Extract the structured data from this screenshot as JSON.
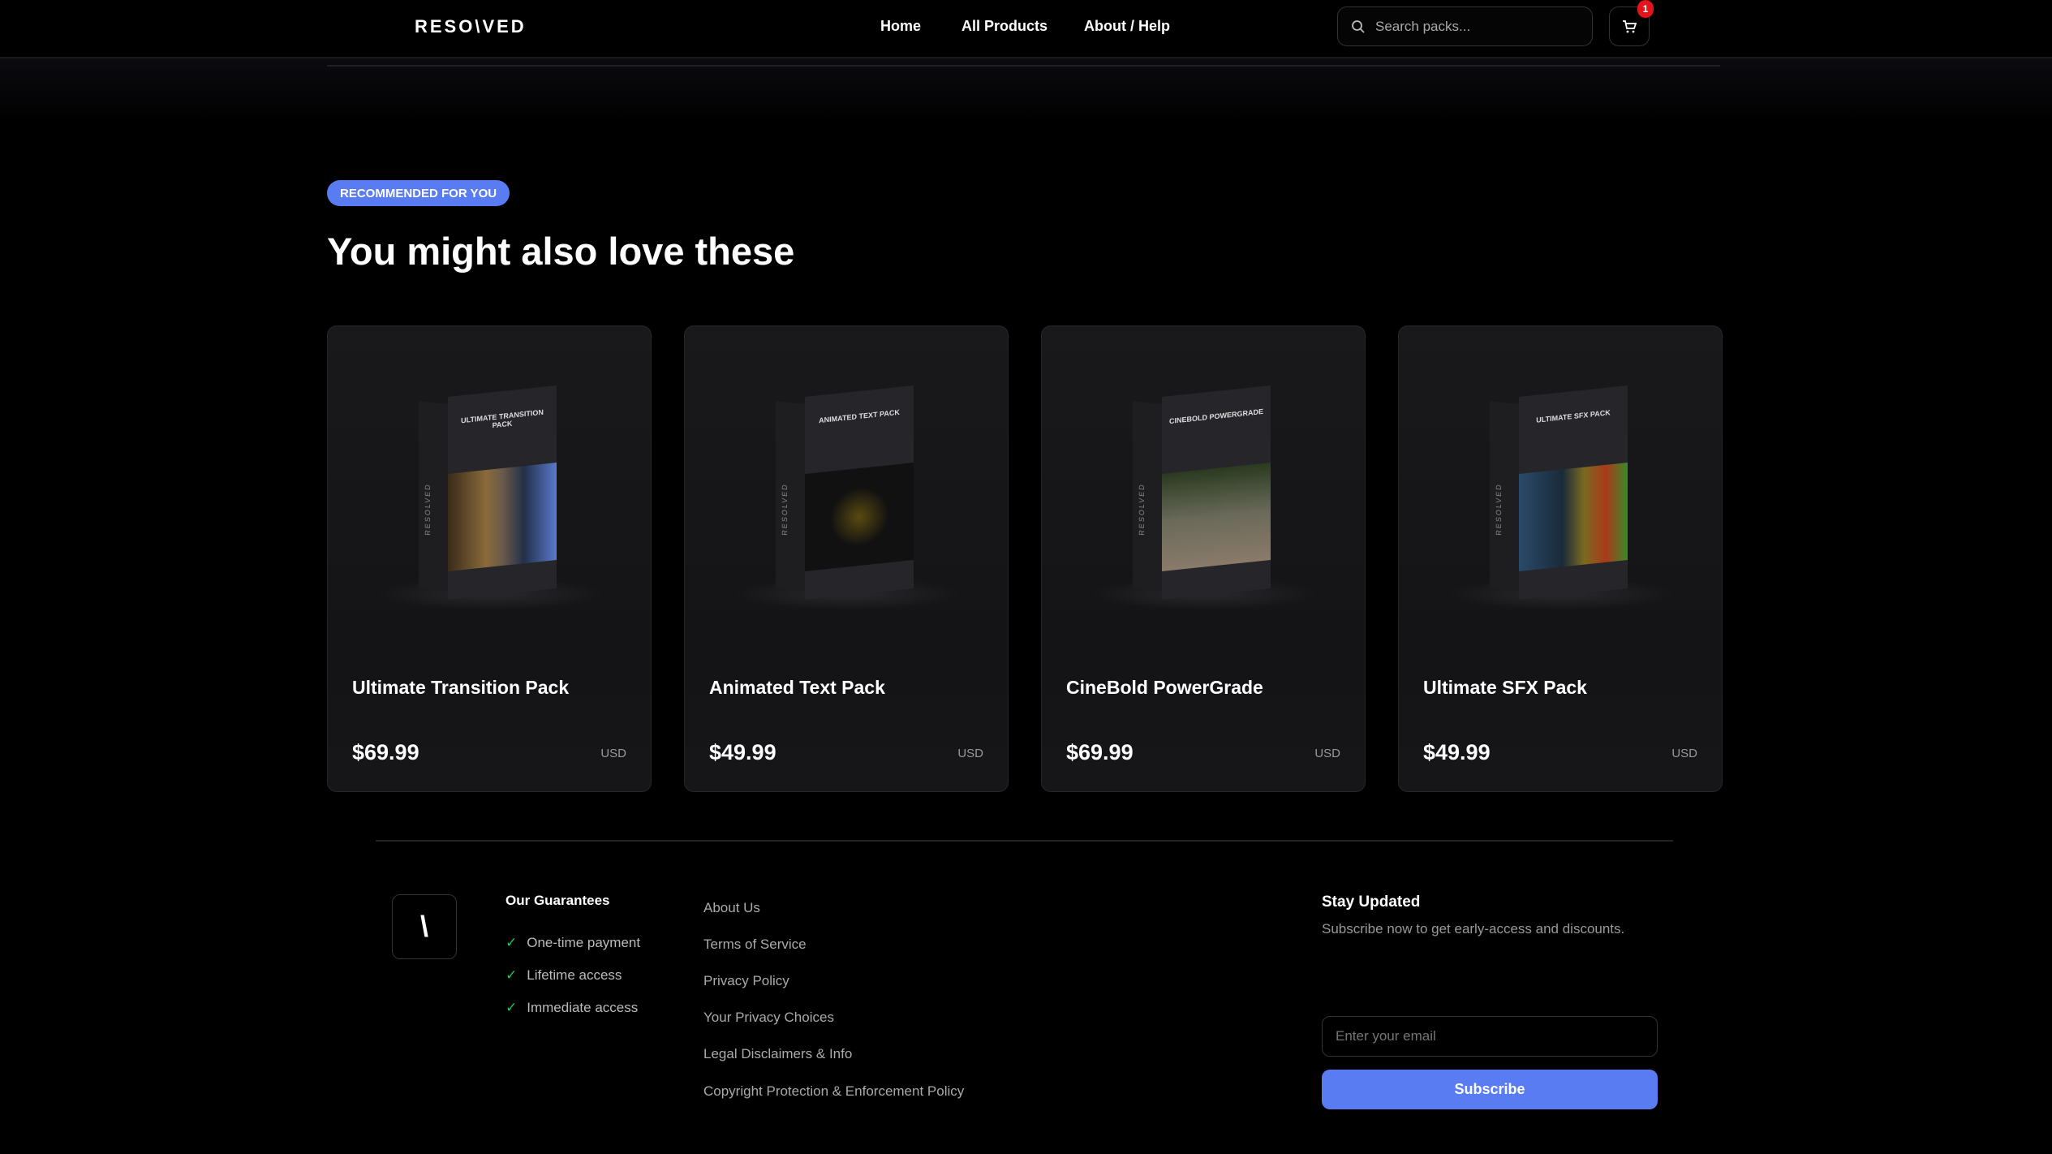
{
  "header": {
    "logo": "RESO\\VED",
    "nav": [
      "Home",
      "All Products",
      "About / Help"
    ],
    "search_placeholder": "Search packs...",
    "cart_count": "1"
  },
  "section": {
    "badge": "RECOMMENDED FOR YOU",
    "title": "You might also love these"
  },
  "products": [
    {
      "name": "Ultimate Transition Pack",
      "box_title": "ULTIMATE TRANSITION PACK",
      "price": "$69.99",
      "currency": "USD"
    },
    {
      "name": "Animated Text Pack",
      "box_title": "ANIMATED TEXT PACK",
      "price": "$49.99",
      "currency": "USD"
    },
    {
      "name": "CineBold PowerGrade",
      "box_title": "CINEBOLD POWERGRADE",
      "price": "$69.99",
      "currency": "USD"
    },
    {
      "name": "Ultimate SFX Pack",
      "box_title": "ULTIMATE SFX PACK",
      "price": "$49.99",
      "currency": "USD"
    }
  ],
  "box_brand": "RESOLVED",
  "footer": {
    "logo_mark": "\\",
    "guarantees_title": "Our Guarantees",
    "guarantees": [
      "One-time payment",
      "Lifetime access",
      "Immediate access"
    ],
    "links": [
      "About Us",
      "Terms of Service",
      "Privacy Policy",
      "Your Privacy Choices",
      "Legal Disclaimers & Info",
      "Copyright Protection & Enforcement Policy"
    ],
    "newsletter_title": "Stay Updated",
    "newsletter_text": "Subscribe now to get early-access and discounts.",
    "email_placeholder": "Enter your email",
    "subscribe_label": "Subscribe"
  },
  "colors": {
    "accent": "#5a7cf2",
    "badge_red": "#e5141c",
    "check": "#22c55e"
  }
}
